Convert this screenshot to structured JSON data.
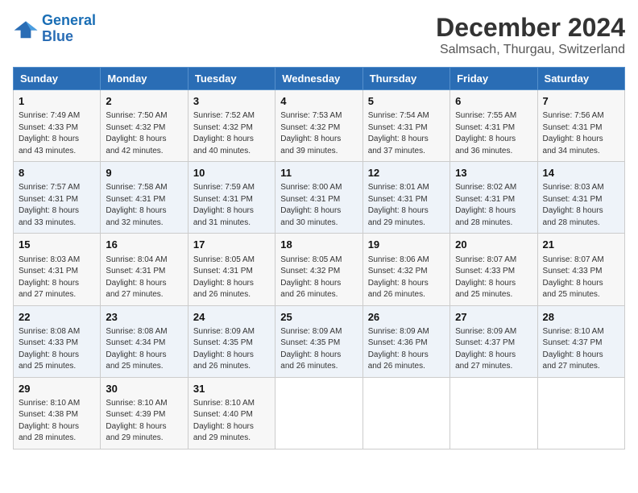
{
  "logo": {
    "line1": "General",
    "line2": "Blue"
  },
  "title": "December 2024",
  "subtitle": "Salmsach, Thurgau, Switzerland",
  "days_of_week": [
    "Sunday",
    "Monday",
    "Tuesday",
    "Wednesday",
    "Thursday",
    "Friday",
    "Saturday"
  ],
  "weeks": [
    [
      {
        "day": "1",
        "info": "Sunrise: 7:49 AM\nSunset: 4:33 PM\nDaylight: 8 hours\nand 43 minutes."
      },
      {
        "day": "2",
        "info": "Sunrise: 7:50 AM\nSunset: 4:32 PM\nDaylight: 8 hours\nand 42 minutes."
      },
      {
        "day": "3",
        "info": "Sunrise: 7:52 AM\nSunset: 4:32 PM\nDaylight: 8 hours\nand 40 minutes."
      },
      {
        "day": "4",
        "info": "Sunrise: 7:53 AM\nSunset: 4:32 PM\nDaylight: 8 hours\nand 39 minutes."
      },
      {
        "day": "5",
        "info": "Sunrise: 7:54 AM\nSunset: 4:31 PM\nDaylight: 8 hours\nand 37 minutes."
      },
      {
        "day": "6",
        "info": "Sunrise: 7:55 AM\nSunset: 4:31 PM\nDaylight: 8 hours\nand 36 minutes."
      },
      {
        "day": "7",
        "info": "Sunrise: 7:56 AM\nSunset: 4:31 PM\nDaylight: 8 hours\nand 34 minutes."
      }
    ],
    [
      {
        "day": "8",
        "info": "Sunrise: 7:57 AM\nSunset: 4:31 PM\nDaylight: 8 hours\nand 33 minutes."
      },
      {
        "day": "9",
        "info": "Sunrise: 7:58 AM\nSunset: 4:31 PM\nDaylight: 8 hours\nand 32 minutes."
      },
      {
        "day": "10",
        "info": "Sunrise: 7:59 AM\nSunset: 4:31 PM\nDaylight: 8 hours\nand 31 minutes."
      },
      {
        "day": "11",
        "info": "Sunrise: 8:00 AM\nSunset: 4:31 PM\nDaylight: 8 hours\nand 30 minutes."
      },
      {
        "day": "12",
        "info": "Sunrise: 8:01 AM\nSunset: 4:31 PM\nDaylight: 8 hours\nand 29 minutes."
      },
      {
        "day": "13",
        "info": "Sunrise: 8:02 AM\nSunset: 4:31 PM\nDaylight: 8 hours\nand 28 minutes."
      },
      {
        "day": "14",
        "info": "Sunrise: 8:03 AM\nSunset: 4:31 PM\nDaylight: 8 hours\nand 28 minutes."
      }
    ],
    [
      {
        "day": "15",
        "info": "Sunrise: 8:03 AM\nSunset: 4:31 PM\nDaylight: 8 hours\nand 27 minutes."
      },
      {
        "day": "16",
        "info": "Sunrise: 8:04 AM\nSunset: 4:31 PM\nDaylight: 8 hours\nand 27 minutes."
      },
      {
        "day": "17",
        "info": "Sunrise: 8:05 AM\nSunset: 4:31 PM\nDaylight: 8 hours\nand 26 minutes."
      },
      {
        "day": "18",
        "info": "Sunrise: 8:05 AM\nSunset: 4:32 PM\nDaylight: 8 hours\nand 26 minutes."
      },
      {
        "day": "19",
        "info": "Sunrise: 8:06 AM\nSunset: 4:32 PM\nDaylight: 8 hours\nand 26 minutes."
      },
      {
        "day": "20",
        "info": "Sunrise: 8:07 AM\nSunset: 4:33 PM\nDaylight: 8 hours\nand 25 minutes."
      },
      {
        "day": "21",
        "info": "Sunrise: 8:07 AM\nSunset: 4:33 PM\nDaylight: 8 hours\nand 25 minutes."
      }
    ],
    [
      {
        "day": "22",
        "info": "Sunrise: 8:08 AM\nSunset: 4:33 PM\nDaylight: 8 hours\nand 25 minutes."
      },
      {
        "day": "23",
        "info": "Sunrise: 8:08 AM\nSunset: 4:34 PM\nDaylight: 8 hours\nand 25 minutes."
      },
      {
        "day": "24",
        "info": "Sunrise: 8:09 AM\nSunset: 4:35 PM\nDaylight: 8 hours\nand 26 minutes."
      },
      {
        "day": "25",
        "info": "Sunrise: 8:09 AM\nSunset: 4:35 PM\nDaylight: 8 hours\nand 26 minutes."
      },
      {
        "day": "26",
        "info": "Sunrise: 8:09 AM\nSunset: 4:36 PM\nDaylight: 8 hours\nand 26 minutes."
      },
      {
        "day": "27",
        "info": "Sunrise: 8:09 AM\nSunset: 4:37 PM\nDaylight: 8 hours\nand 27 minutes."
      },
      {
        "day": "28",
        "info": "Sunrise: 8:10 AM\nSunset: 4:37 PM\nDaylight: 8 hours\nand 27 minutes."
      }
    ],
    [
      {
        "day": "29",
        "info": "Sunrise: 8:10 AM\nSunset: 4:38 PM\nDaylight: 8 hours\nand 28 minutes."
      },
      {
        "day": "30",
        "info": "Sunrise: 8:10 AM\nSunset: 4:39 PM\nDaylight: 8 hours\nand 29 minutes."
      },
      {
        "day": "31",
        "info": "Sunrise: 8:10 AM\nSunset: 4:40 PM\nDaylight: 8 hours\nand 29 minutes."
      },
      null,
      null,
      null,
      null
    ]
  ]
}
